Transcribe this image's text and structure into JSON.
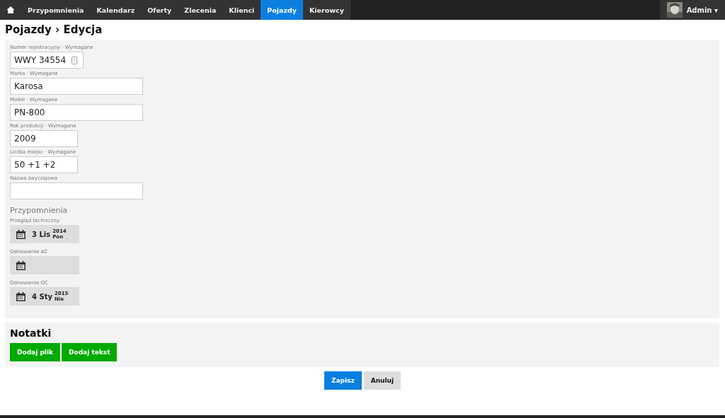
{
  "nav": {
    "items": [
      {
        "label": "Przypomnienia",
        "selected": false
      },
      {
        "label": "Kalendarz",
        "selected": false
      },
      {
        "label": "Oferty",
        "selected": false
      },
      {
        "label": "Zlecenia",
        "selected": false
      },
      {
        "label": "Klienci",
        "selected": false
      },
      {
        "label": "Pojazdy",
        "selected": true
      },
      {
        "label": "Kierowcy",
        "selected": false
      }
    ],
    "user": {
      "name": "Admin",
      "caret": "▾"
    }
  },
  "heading": "Pojazdy › Edycja",
  "fields": [
    {
      "label": "Numer rejestracyjny · Wymagane",
      "value": "WWY 34554",
      "kind": "plate"
    },
    {
      "label": "Marka · Wymagane",
      "value": "Karosa",
      "kind": "wide"
    },
    {
      "label": "Model · Wymagane",
      "value": "PN-800",
      "kind": "wide"
    },
    {
      "label": "Rok produkcji · Wymagane",
      "value": "2009",
      "kind": "short"
    },
    {
      "label": "Liczba miejsc · Wymagane",
      "value": "50 +1 +2",
      "kind": "short"
    },
    {
      "label": "Nazwa zwyczajowa",
      "kind": "wide"
    }
  ],
  "reminders": {
    "title": "Przypomnienia",
    "items": [
      {
        "label": "Przegląd techniczny",
        "day": "3 Lis",
        "year": "2014",
        "weekday": "Pon"
      },
      {
        "label": "Odnowienie AC"
      },
      {
        "label": "Odnowienie OC",
        "day": "4 Sty",
        "year": "2015",
        "weekday": "Nie"
      }
    ]
  },
  "notes": {
    "title": "Notatki",
    "buttons": [
      "Dodaj plik",
      "Dodaj tekst"
    ]
  },
  "actions": {
    "save": "Zapisz",
    "cancel": "Anuluj"
  }
}
